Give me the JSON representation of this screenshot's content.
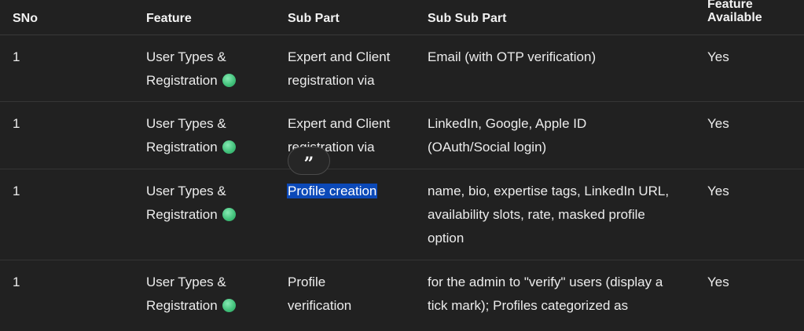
{
  "table": {
    "headers": [
      "SNo",
      "Feature",
      "Sub Part",
      "Sub Sub Part",
      "Feature Available"
    ],
    "rows": [
      {
        "sno": "1",
        "feature": [
          "User Types &",
          "Registration"
        ],
        "sub_part": [
          "Expert and Client",
          "registration via"
        ],
        "sub_sub_part": [
          "Email (with OTP verification)"
        ],
        "available": "Yes"
      },
      {
        "sno": "1",
        "feature": [
          "User Types &",
          "Registration"
        ],
        "sub_part": [
          "Expert and Client",
          "registration via"
        ],
        "sub_sub_part": [
          "LinkedIn, Google, Apple ID",
          "(OAuth/Social login)"
        ],
        "available": "Yes"
      },
      {
        "sno": "1",
        "feature": [
          "User Types &",
          "Registration"
        ],
        "sub_part": [
          "Profile creation"
        ],
        "sub_sub_part": [
          "name, bio, expertise tags, LinkedIn URL,",
          "availability slots, rate, masked profile",
          "option"
        ],
        "available": "Yes"
      },
      {
        "sno": "1",
        "feature": [
          "User Types &",
          "Registration"
        ],
        "sub_part": [
          "Profile",
          "verification"
        ],
        "sub_sub_part": [
          "for the admin to \"verify\" users (display a",
          "tick mark); Profiles categorized as"
        ],
        "available": "Yes"
      }
    ]
  },
  "quote_button": {
    "label": "”"
  },
  "colors": {
    "status_dot": "#3fbf78",
    "selection": "#0b49b8",
    "background": "#212121"
  }
}
